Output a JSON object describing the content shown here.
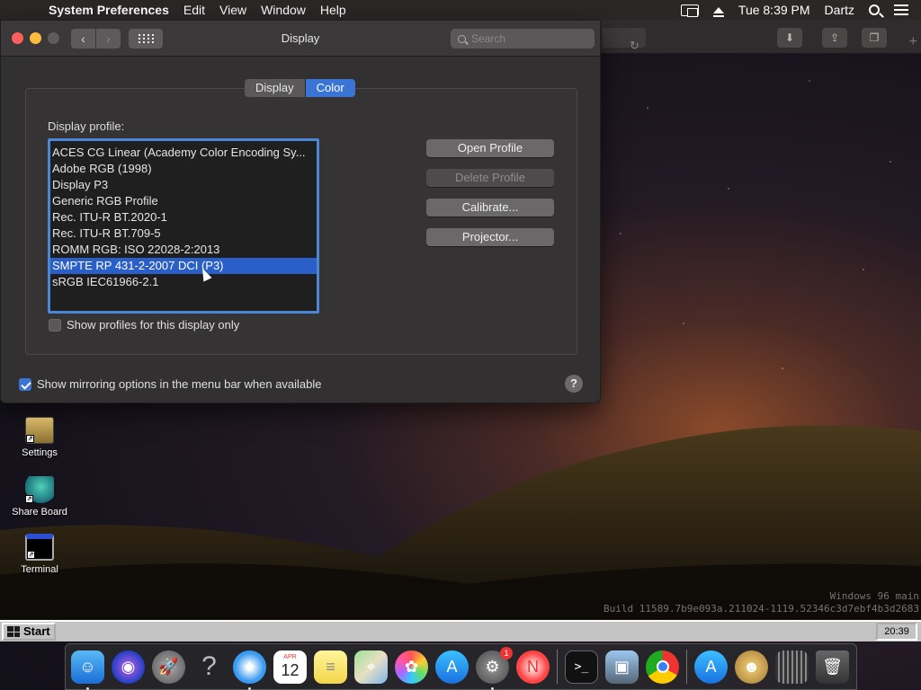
{
  "menubar": {
    "app_name": "System Preferences",
    "items": [
      "Edit",
      "View",
      "Window",
      "Help"
    ],
    "datetime": "Tue 8:39 PM",
    "user": "Dartz"
  },
  "window": {
    "title": "Display",
    "search_placeholder": "Search",
    "tabs": [
      {
        "label": "Display",
        "active": false
      },
      {
        "label": "Color",
        "active": true
      }
    ],
    "profile_label": "Display profile:",
    "profiles": [
      "ACES CG Linear (Academy Color Encoding Sy...",
      "Adobe RGB (1998)",
      "Display P3",
      "Generic RGB Profile",
      "Rec. ITU-R BT.2020-1",
      "Rec. ITU-R BT.709-5",
      "ROMM RGB: ISO 22028-2:2013",
      "SMPTE RP 431-2-2007 DCI (P3)",
      "sRGB IEC61966-2.1"
    ],
    "selected_profile_index": 7,
    "buttons": {
      "open": "Open Profile",
      "delete": "Delete Profile",
      "calibrate": "Calibrate...",
      "projector": "Projector..."
    },
    "show_profiles_only": {
      "label": "Show profiles for this display only",
      "checked": false
    },
    "show_mirroring": {
      "label": "Show mirroring options in the menu bar when available",
      "checked": true
    },
    "help": "?"
  },
  "desktop": {
    "icons": [
      {
        "label": "Settings"
      },
      {
        "label": "Share Board"
      },
      {
        "label": "Terminal"
      }
    ],
    "watermark_line1": "Windows 96 main",
    "watermark_line2": "Build 11589.7b9e093a.211024-1119.52346c3d7ebf4b3d2683"
  },
  "taskbar": {
    "start_label": "Start",
    "clock": "20:39"
  },
  "dock": {
    "calendar_month": "APR",
    "calendar_day": "12",
    "prefs_badge": "1"
  }
}
